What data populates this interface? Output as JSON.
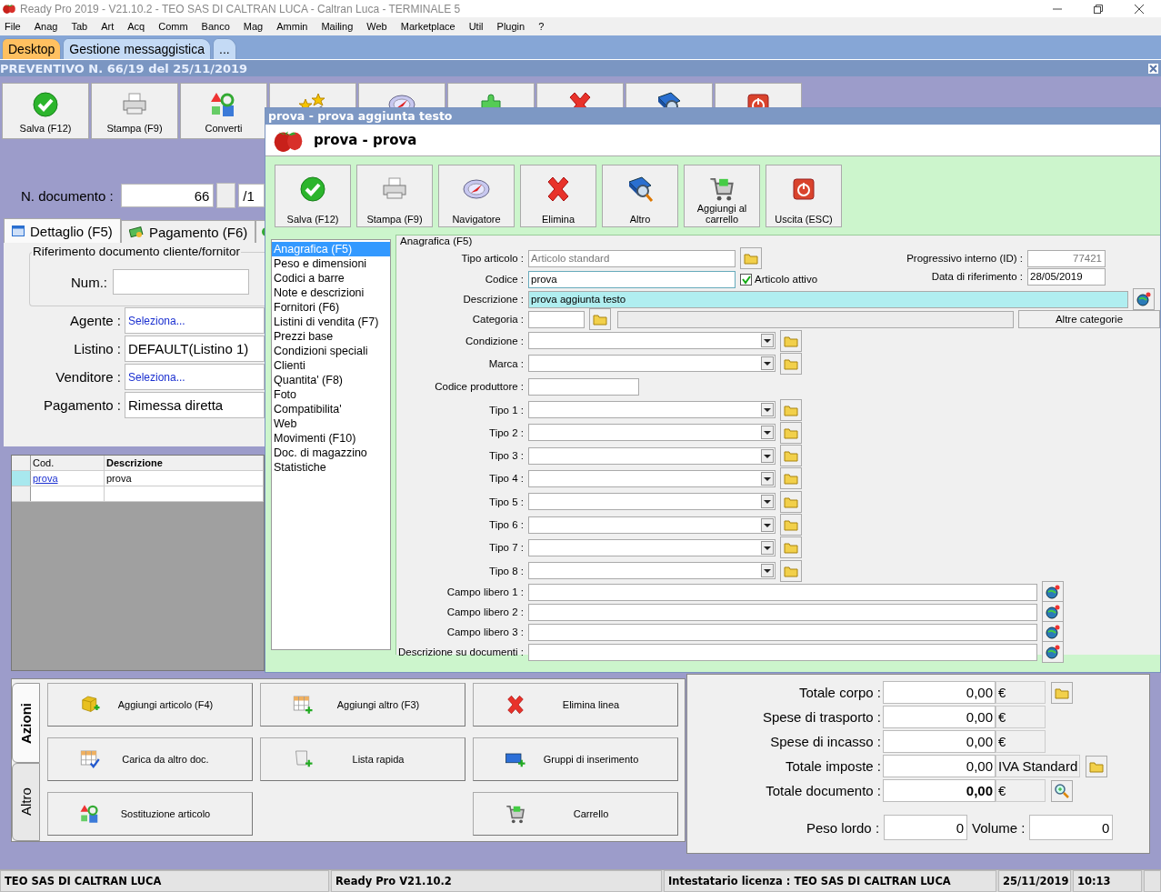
{
  "window": {
    "title": "Ready Pro 2019 - V21.10.2 - TEO SAS DI CALTRAN LUCA - Caltran Luca - TERMINALE 5"
  },
  "menu": [
    "File",
    "Anag",
    "Tab",
    "Art",
    "Acq",
    "Comm",
    "Banco",
    "Mag",
    "Ammin",
    "Mailing",
    "Web",
    "Marketplace",
    "Util",
    "Plugin",
    "?"
  ],
  "tabs": [
    {
      "label": "Desktop",
      "selected": true
    },
    {
      "label": "Gestione messaggistica",
      "selected": false
    },
    {
      "label": "...",
      "selected": false
    }
  ],
  "document": {
    "title": "PREVENTIVO N. 66/19 del 25/11/2019"
  },
  "toolbar": [
    "Salva (F12)",
    "Stampa (F9)",
    "Converti"
  ],
  "doc_number": {
    "label": "N. documento :",
    "value": "66",
    "suffix": "/1"
  },
  "detail_tabs": [
    {
      "label": "Dettaglio (F5)",
      "selected": true
    },
    {
      "label": "Pagamento (F6)",
      "selected": false
    }
  ],
  "reference": {
    "legend": "Riferimento documento cliente/fornitor",
    "num_label": "Num.:"
  },
  "fields": [
    {
      "label": "Agente :",
      "value": "Seleziona...",
      "kind": "link"
    },
    {
      "label": "Listino :",
      "value": "DEFAULT(Listino 1)",
      "kind": "text"
    },
    {
      "label": "Venditore :",
      "value": "Seleziona...",
      "kind": "link"
    },
    {
      "label": "Pagamento :",
      "value": "Rimessa diretta",
      "kind": "text"
    }
  ],
  "lines": {
    "columns": [
      "Cod.",
      "Descrizione"
    ],
    "rows": [
      {
        "code": "prova",
        "description": "prova",
        "selected": true
      }
    ]
  },
  "actions": {
    "tabs": [
      {
        "label": "Azioni",
        "selected": true
      },
      {
        "label": "Altro",
        "selected": false
      }
    ],
    "buttons": [
      "Aggiungi articolo (F4)",
      "Aggiungi altro (F3)",
      "Elimina linea",
      "Carica da altro doc.",
      "Lista rapida",
      "Gruppi di inserimento",
      "Sostituzione articolo",
      "Carrello"
    ]
  },
  "totals": [
    {
      "label": "Totale corpo :",
      "value": "0,00",
      "unit": "€",
      "kind": "folder"
    },
    {
      "label": "Spese di trasporto :",
      "value": "0,00",
      "unit": "€",
      "kind": "plain"
    },
    {
      "label": "Spese di incasso :",
      "value": "0,00",
      "unit": "€",
      "kind": "plain"
    },
    {
      "label": "Totale imposte :",
      "value": "0,00",
      "unit": "IVA Standard",
      "kind": "folder"
    },
    {
      "label": "Totale documento :",
      "value": "0,00",
      "unit": "€",
      "kind": "zoom",
      "bold": true
    }
  ],
  "weights": [
    {
      "label": "Peso lordo :",
      "value": "0"
    },
    {
      "label": "Volume :",
      "value": "0"
    }
  ],
  "status_bar": [
    "TEO SAS DI CALTRAN LUCA",
    "Ready Pro V21.10.2",
    "Intestatario licenza : TEO SAS DI CALTRAN LUCA",
    "25/11/2019",
    "10:13"
  ],
  "dialog": {
    "title": "prova - prova aggiunta testo",
    "heading": "prova - prova",
    "toolbar": [
      "Salva (F12)",
      "Stampa (F9)",
      "Navigatore",
      "Elimina",
      "Altro",
      "Aggiungi al carrello",
      "Uscita (ESC)"
    ],
    "sections": [
      {
        "label": "Anagrafica (F5)",
        "selected": true
      },
      {
        "label": "Peso e dimensioni",
        "selected": false
      },
      {
        "label": "Codici a barre",
        "selected": false
      },
      {
        "label": "Note e descrizioni",
        "selected": false
      },
      {
        "label": "Fornitori (F6)",
        "selected": false
      },
      {
        "label": "Listini di vendita (F7)",
        "selected": false
      },
      {
        "label": "Prezzi base",
        "selected": false
      },
      {
        "label": "Condizioni speciali",
        "selected": false
      },
      {
        "label": "Clienti",
        "selected": false
      },
      {
        "label": "Quantita' (F8)",
        "selected": false
      },
      {
        "label": "Foto",
        "selected": false
      },
      {
        "label": "Compatibilita'",
        "selected": false
      },
      {
        "label": "Web",
        "selected": false
      },
      {
        "label": "Movimenti (F10)",
        "selected": false
      },
      {
        "label": "Doc. di magazzino",
        "selected": false
      },
      {
        "label": "Statistiche",
        "selected": false
      }
    ],
    "form": {
      "legend": "Anagrafica (F5)",
      "article_type": {
        "label": "Tipo articolo :",
        "value": "Articolo standard"
      },
      "progressive": {
        "label": "Progressivo interno (ID) :",
        "value": "77421"
      },
      "code": {
        "label": "Codice :",
        "value": "prova"
      },
      "active": {
        "label": "Articolo attivo",
        "checked": true
      },
      "reference_date": {
        "label": "Data di riferimento :",
        "value": "28/05/2019"
      },
      "description": {
        "label": "Descrizione :",
        "value": "prova aggiunta testo"
      },
      "category": {
        "label": "Categoria :",
        "button": "Altre categorie"
      },
      "rows": [
        {
          "label": "Condizione :",
          "kind": "combo"
        },
        {
          "label": "Marca :",
          "kind": "combo"
        },
        {
          "label": "Codice produttore :",
          "kind": "short"
        },
        {
          "label": "Tipo 1 :",
          "kind": "combo"
        },
        {
          "label": "Tipo 2 :",
          "kind": "combo"
        },
        {
          "label": "Tipo 3 :",
          "kind": "combo"
        },
        {
          "label": "Tipo 4 :",
          "kind": "combo"
        },
        {
          "label": "Tipo 5 :",
          "kind": "combo"
        },
        {
          "label": "Tipo 6 :",
          "kind": "combo"
        },
        {
          "label": "Tipo 7 :",
          "kind": "combo"
        },
        {
          "label": "Tipo 8 :",
          "kind": "combo"
        },
        {
          "label": "Campo libero 1 :",
          "kind": "wide"
        },
        {
          "label": "Campo libero 2 :",
          "kind": "wide"
        },
        {
          "label": "Campo libero 3 :",
          "kind": "wide"
        },
        {
          "label": "Descrizione su documenti :",
          "kind": "wide"
        }
      ]
    }
  }
}
